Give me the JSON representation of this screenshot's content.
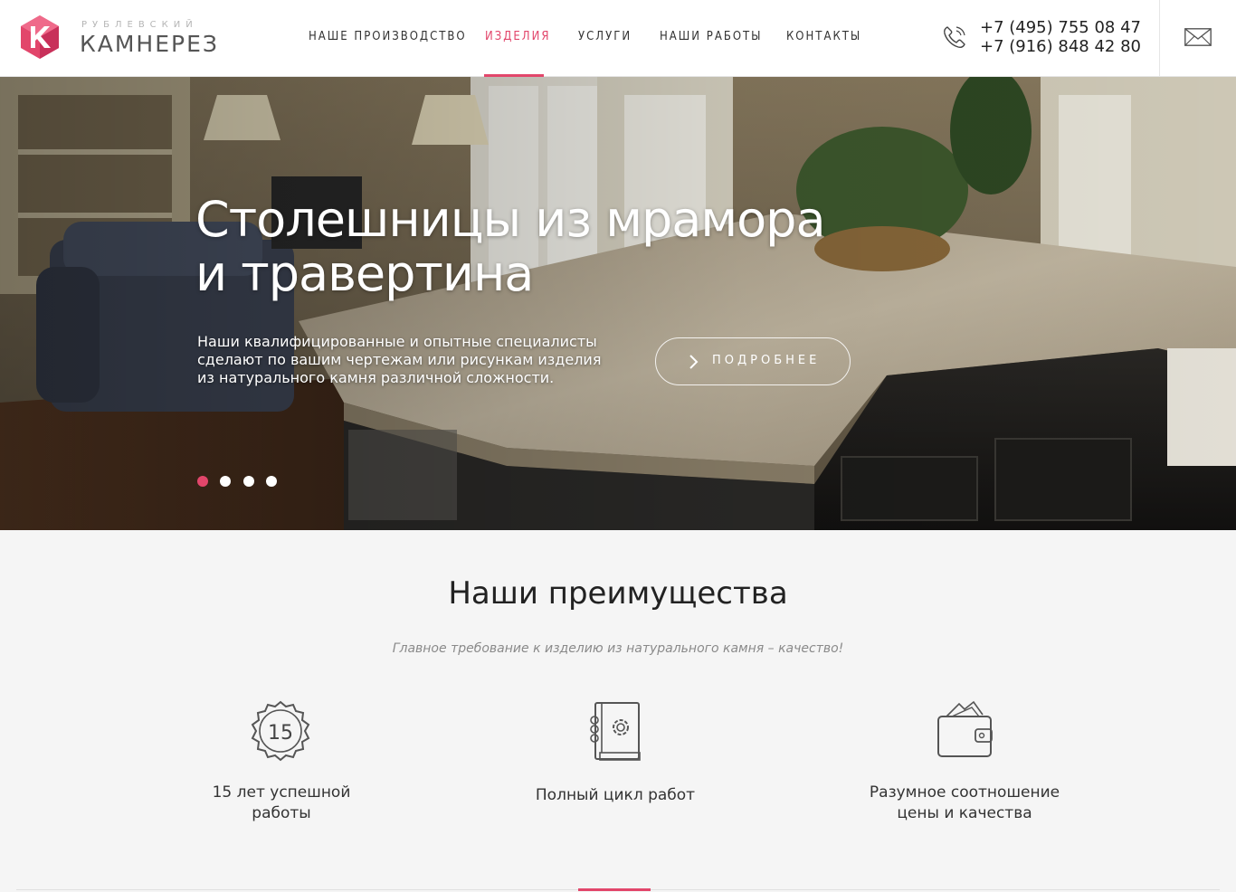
{
  "brand": {
    "subtitle": "РУБЛЕВСКИЙ",
    "name": "КАМНЕРЕЗ",
    "accent_color": "#e2466b"
  },
  "nav": {
    "items": [
      {
        "label": "НАШЕ ПРОИЗВОДСТВО"
      },
      {
        "label": "ИЗДЕЛИЯ",
        "active": true
      },
      {
        "label": "УСЛУГИ"
      },
      {
        "label": "НАШИ РАБОТЫ"
      },
      {
        "label": "КОНТАКТЫ"
      }
    ]
  },
  "contacts": {
    "phone_icon": "phone-icon",
    "phone1": "+7 (495) 755 08 47",
    "phone2": "+7 (916) 848 42 80",
    "mail_icon": "envelope-icon"
  },
  "hero": {
    "title_line1": "Столешницы из мрамора",
    "title_line2": "и травертина",
    "text": "Наши квалифицированные и опытные специалисты сделают по вашим чертежам или рисункам изделия из натурального камня различной сложности.",
    "button_label": "ПОДРОБНЕЕ",
    "slides_total": 4,
    "slide_active": 1
  },
  "advantages": {
    "title": "Наши преимущества",
    "subtitle": "Главное требование к изделию из натурального камня – качество!",
    "items": [
      {
        "icon": "badge-15-icon",
        "badge_text": "15",
        "label_line1": "15 лет успешной",
        "label_line2": "работы"
      },
      {
        "icon": "book-gear-icon",
        "label_line1": "Полный цикл работ",
        "label_line2": ""
      },
      {
        "icon": "wallet-icon",
        "label_line1": "Разумное соотношение",
        "label_line2": "цены и качества"
      }
    ]
  }
}
